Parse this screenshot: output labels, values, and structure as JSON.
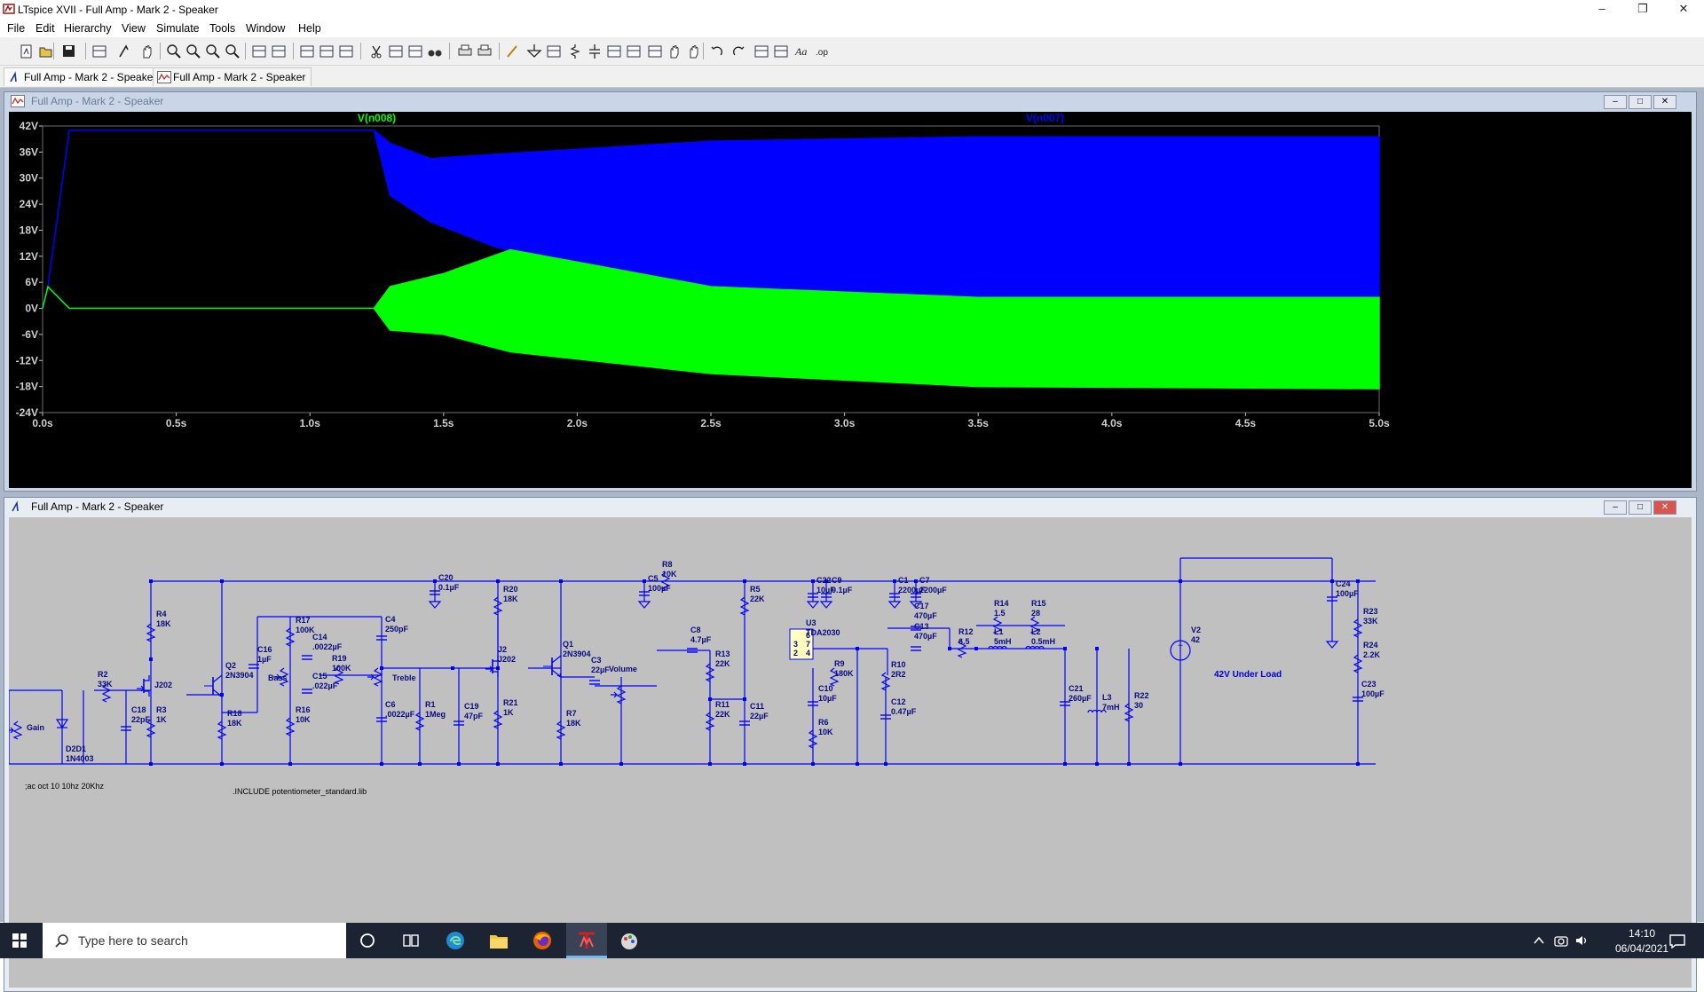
{
  "app": {
    "title": "LTspice XVII - Full Amp - Mark 2 - Speaker"
  },
  "menu": [
    "File",
    "Edit",
    "Hierarchy",
    "View",
    "Simulate",
    "Tools",
    "Window",
    "Help"
  ],
  "tabs": [
    {
      "label": "Full Amp - Mark 2 - Speaker",
      "icon": "schematic-icon"
    },
    {
      "label": "Full Amp - Mark 2 - Speaker",
      "icon": "waveform-icon"
    }
  ],
  "waveform_window": {
    "title": "Full Amp - Mark 2 - Speaker"
  },
  "schematic_window": {
    "title": "Full Amp - Mark 2 - Speaker"
  },
  "colors": {
    "trace1": "#00ff00",
    "trace2": "#0000ff",
    "plot_bg": "#000000",
    "schematic_bg": "#c0c0c0",
    "wire": "#0000ff"
  },
  "chart_data": {
    "type": "line",
    "series": [
      {
        "name": "V(n008)",
        "color": "#00ff00"
      },
      {
        "name": "V(n007)",
        "color": "#0000ff"
      }
    ],
    "x_ticks": [
      "0.0s",
      "0.5s",
      "1.0s",
      "1.5s",
      "2.0s",
      "2.5s",
      "3.0s",
      "3.5s",
      "4.0s",
      "4.5s",
      "5.0s"
    ],
    "y_ticks": [
      "42V",
      "36V",
      "30V",
      "24V",
      "18V",
      "12V",
      "6V",
      "0V",
      "-6V",
      "-12V",
      "-18V",
      "-24V"
    ],
    "xlim": [
      0,
      5
    ],
    "ylim": [
      -24,
      42
    ],
    "grid": false,
    "envelope": {
      "V(n007)": {
        "x": [
          0,
          0.02,
          0.1,
          1.24,
          1.3,
          1.45,
          1.7,
          2.5,
          3.5,
          5.0
        ],
        "upper": [
          0,
          5,
          41,
          41,
          38,
          34.5,
          35.5,
          38.5,
          39.5,
          39.5
        ],
        "lower": [
          0,
          5,
          41,
          41,
          26,
          20,
          14,
          4,
          2.5,
          2.5
        ]
      },
      "V(n008)": {
        "x": [
          0,
          0.02,
          0.1,
          1.24,
          1.3,
          1.5,
          1.75,
          2.5,
          3.5,
          5.0
        ],
        "upper": [
          0,
          5,
          0,
          0,
          5,
          8,
          13.5,
          5,
          2.5,
          2.5
        ],
        "lower": [
          0,
          5,
          0,
          0,
          -5,
          -6,
          -10,
          -15,
          -18,
          -18.5
        ]
      }
    }
  },
  "schematic": {
    "components": [
      {
        "id": "R2",
        "label": "R2",
        "value": "33K"
      },
      {
        "id": "D2",
        "label": "D2D1",
        "value": "1N4003"
      },
      {
        "id": "Gain",
        "label": "Gain",
        "value": ""
      },
      {
        "id": "C18",
        "label": "C18",
        "value": "22pF"
      },
      {
        "id": "R4",
        "label": "R4",
        "value": "18K"
      },
      {
        "id": "R3",
        "label": "R3",
        "value": "1K"
      },
      {
        "id": "J202",
        "label": "J202",
        "value": ""
      },
      {
        "id": "Q2",
        "label": "Q2",
        "value": "2N3904"
      },
      {
        "id": "R18",
        "label": "R18",
        "value": "18K"
      },
      {
        "id": "C16",
        "label": "C16",
        "value": "1µF"
      },
      {
        "id": "Bass",
        "label": "Bass",
        "value": ""
      },
      {
        "id": "R17",
        "label": "R17",
        "value": "100K"
      },
      {
        "id": "C14",
        "label": "C14",
        "value": ".0022µF"
      },
      {
        "id": "R19",
        "label": "R19",
        "value": "100K"
      },
      {
        "id": "C15",
        "label": "C15",
        "value": ".022µF"
      },
      {
        "id": "R16",
        "label": "R16",
        "value": "10K"
      },
      {
        "id": "C4",
        "label": "C4",
        "value": "250pF"
      },
      {
        "id": "Treble",
        "label": "Treble",
        "value": ""
      },
      {
        "id": "C6",
        "label": "C6",
        "value": ".0022µF"
      },
      {
        "id": "R1",
        "label": "R1",
        "value": "1Meg"
      },
      {
        "id": "C19",
        "label": "C19",
        "value": "47pF"
      },
      {
        "id": "C20",
        "label": "C20",
        "value": "0.1µF"
      },
      {
        "id": "R20",
        "label": "R20",
        "value": "18K"
      },
      {
        "id": "J2",
        "label": "J2",
        "value": "J202"
      },
      {
        "id": "R21",
        "label": "R21",
        "value": "1K"
      },
      {
        "id": "Q1",
        "label": "Q1",
        "value": "2N3904"
      },
      {
        "id": "R7",
        "label": "R7",
        "value": "18K"
      },
      {
        "id": "C3",
        "label": "C3",
        "value": "22µF"
      },
      {
        "id": "Volume",
        "label": "Volume",
        "value": ""
      },
      {
        "id": "R8",
        "label": "R8",
        "value": "10K"
      },
      {
        "id": "C5",
        "label": "C5",
        "value": "100µF"
      },
      {
        "id": "C8",
        "label": "C8",
        "value": "4.7µF"
      },
      {
        "id": "R13",
        "label": "R13",
        "value": "22K"
      },
      {
        "id": "R11",
        "label": "R11",
        "value": "22K"
      },
      {
        "id": "R5",
        "label": "R5",
        "value": "22K"
      },
      {
        "id": "C11",
        "label": "C11",
        "value": "22µF"
      },
      {
        "id": "C22",
        "label": "C22",
        "value": "10µF"
      },
      {
        "id": "C9",
        "label": "C9",
        "value": "0.1µF"
      },
      {
        "id": "U3",
        "label": "U3",
        "value": "TDA2030"
      },
      {
        "id": "R9",
        "label": "R9",
        "value": "180K"
      },
      {
        "id": "C10",
        "label": "C10",
        "value": "10µF"
      },
      {
        "id": "R6",
        "label": "R6",
        "value": "10K"
      },
      {
        "id": "C1",
        "label": "C1",
        "value": "2200µF"
      },
      {
        "id": "C7",
        "label": "C7",
        "value": "2200µF"
      },
      {
        "id": "C17",
        "label": "C17",
        "value": "470µF"
      },
      {
        "id": "C13",
        "label": "C13",
        "value": "470µF"
      },
      {
        "id": "R10",
        "label": "R10",
        "value": "2R2"
      },
      {
        "id": "C12",
        "label": "C12",
        "value": "0.47µF"
      },
      {
        "id": "R12",
        "label": "R12",
        "value": "6.5"
      },
      {
        "id": "R14",
        "label": "R14",
        "value": "1.5"
      },
      {
        "id": "L1",
        "label": "L1",
        "value": "5mH"
      },
      {
        "id": "R15",
        "label": "R15",
        "value": "28"
      },
      {
        "id": "L2",
        "label": "L2",
        "value": "0.5mH"
      },
      {
        "id": "C21",
        "label": "C21",
        "value": "260µF"
      },
      {
        "id": "L3",
        "label": "L3",
        "value": "7mH"
      },
      {
        "id": "R22",
        "label": "R22",
        "value": "30"
      },
      {
        "id": "V2",
        "label": "V2",
        "value": "42"
      },
      {
        "id": "C24",
        "label": "C24",
        "value": "100µF"
      },
      {
        "id": "R23",
        "label": "R23",
        "value": "33K"
      },
      {
        "id": "R24",
        "label": "R24",
        "value": "2.2K"
      },
      {
        "id": "C23",
        "label": "C23",
        "value": "100µF"
      }
    ],
    "annotations": [
      {
        "id": "net42",
        "text": "42V Under Load"
      },
      {
        "id": "ac",
        "text": ";ac oct 10 10hz 20Khz"
      },
      {
        "id": "include",
        "text": ".INCLUDE potentiometer_standard.lib"
      }
    ]
  },
  "taskbar": {
    "search_placeholder": "Type here to search",
    "time": "14:10",
    "date": "06/04/2021"
  }
}
